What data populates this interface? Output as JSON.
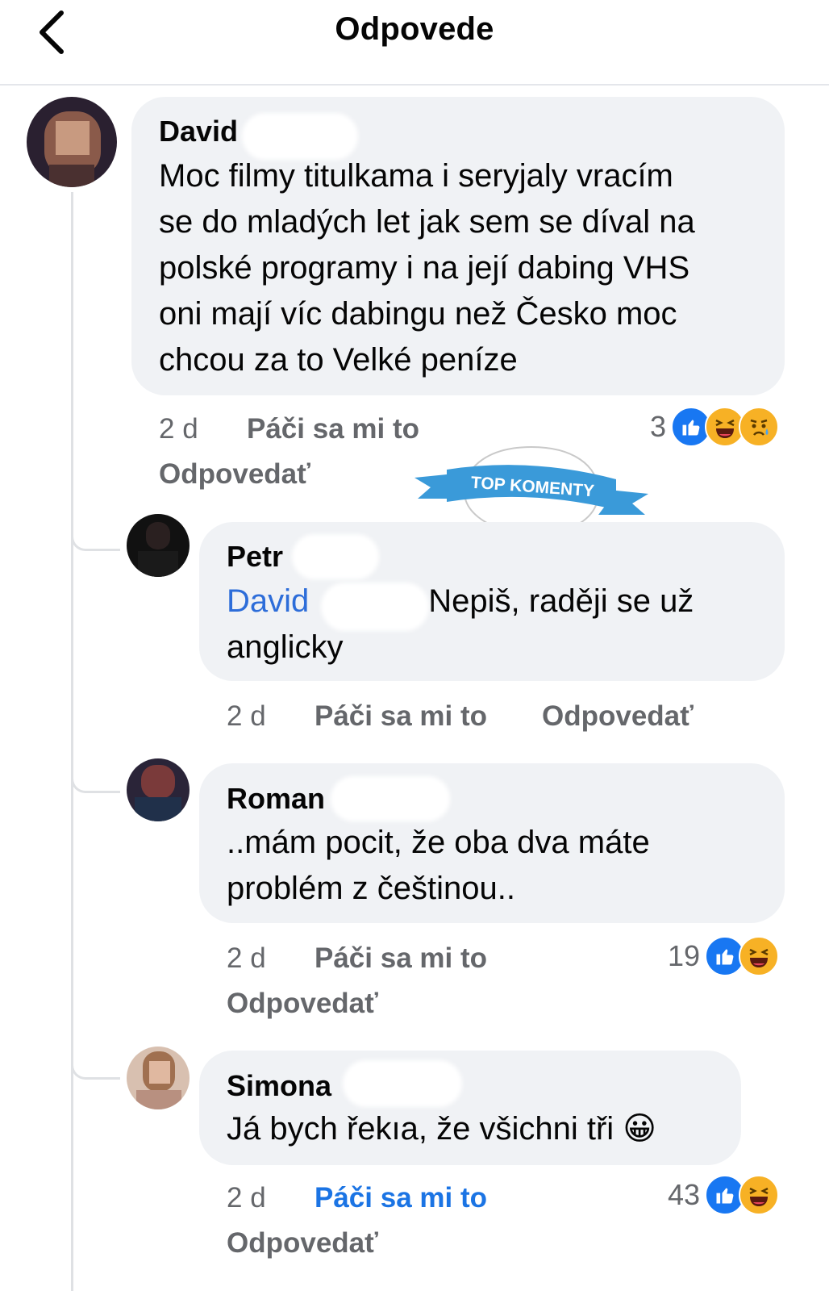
{
  "header": {
    "title": "Odpovede"
  },
  "badge": {
    "text": "TOP KOMENTY"
  },
  "comments": [
    {
      "name": "David",
      "lines": [
        "Moc filmy titulkama i seryjaly vracím",
        "se do mladých let jak sem se díval na",
        "polské programy i na její dabing VHS",
        "oni mají víc dabingu než Česko  moc",
        "chcou za to Velké peníze"
      ],
      "time": "2 d",
      "like": "Páči sa mi to",
      "reply": "Odpovedať",
      "reaction_count": "3",
      "reactions": [
        "like-icon",
        "haha-icon",
        "sad-icon"
      ]
    },
    {
      "name": "Petr",
      "mention": "David",
      "lines": [
        "Nepiš, raději se už",
        "anglicky"
      ],
      "time": "2 d",
      "like": "Páči sa mi to",
      "reply": "Odpovedať"
    },
    {
      "name": "Roman",
      "lines": [
        "..mám pocit, že oba dva máte",
        "problém z češtinou.."
      ],
      "time": "2 d",
      "like": "Páči sa mi to",
      "reply": "Odpovedať",
      "reaction_count": "19",
      "reactions": [
        "like-icon",
        "haha-icon"
      ]
    },
    {
      "name": "Simona",
      "lines": [
        "Já bych řekıa, že všichni tři 😀"
      ],
      "time": "2 d",
      "like": "Páči sa mi to",
      "reply": "Odpovedať",
      "liked": true,
      "reaction_count": "43",
      "reactions": [
        "like-icon",
        "haha-icon"
      ]
    }
  ],
  "colors": {
    "bubble": "#f0f2f5",
    "mention": "#2d6dd9",
    "liked": "#1b74e4",
    "like_reaction": "#1877f2",
    "haha_reaction": "#f7b125",
    "badge_ribbon": "#3a9ad9"
  }
}
